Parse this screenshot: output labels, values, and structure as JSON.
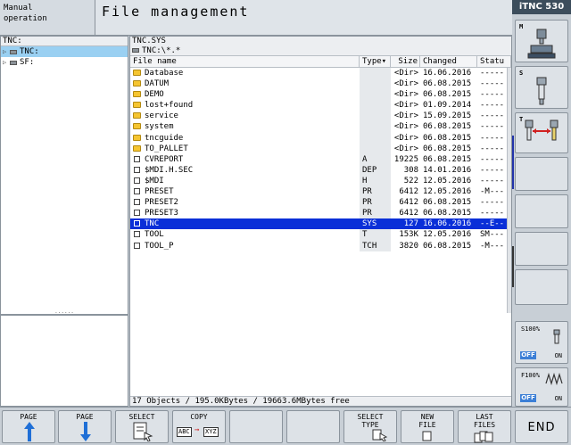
{
  "header": {
    "mode_line1": "Manual",
    "mode_line2": "operation",
    "title": "File management",
    "brand": "iTNC 530"
  },
  "tree": {
    "header": "TNC:",
    "items": [
      {
        "label": "TNC:",
        "selected": true
      },
      {
        "label": "SF:",
        "selected": false
      }
    ],
    "footer": "......"
  },
  "file_table": {
    "path_line1": "TNC.SYS",
    "path_line2": "TNC:\\*.*",
    "columns": {
      "name": "File name",
      "type": "Type▾",
      "size": "Size",
      "changed": "Changed",
      "status": "Statu"
    },
    "rows": [
      {
        "icon": "folder",
        "name": "Database",
        "type": "",
        "size": "<Dir>",
        "changed": "16.06.2016",
        "status": "-----"
      },
      {
        "icon": "folder",
        "name": "DATUM",
        "type": "",
        "size": "<Dir>",
        "changed": "06.08.2015",
        "status": "-----"
      },
      {
        "icon": "folder",
        "name": "DEMO",
        "type": "",
        "size": "<Dir>",
        "changed": "06.08.2015",
        "status": "-----"
      },
      {
        "icon": "folder",
        "name": "lost+found",
        "type": "",
        "size": "<Dir>",
        "changed": "01.09.2014",
        "status": "-----"
      },
      {
        "icon": "folder",
        "name": "service",
        "type": "",
        "size": "<Dir>",
        "changed": "15.09.2015",
        "status": "-----"
      },
      {
        "icon": "folder",
        "name": "system",
        "type": "",
        "size": "<Dir>",
        "changed": "06.08.2015",
        "status": "-----"
      },
      {
        "icon": "folder",
        "name": "tncguide",
        "type": "",
        "size": "<Dir>",
        "changed": "06.08.2015",
        "status": "-----"
      },
      {
        "icon": "folder",
        "name": "TO_PALLET",
        "type": "",
        "size": "<Dir>",
        "changed": "06.08.2015",
        "status": "-----"
      },
      {
        "icon": "file",
        "name": "CVREPORT",
        "type": "A",
        "size": "19225",
        "changed": "06.08.2015",
        "status": "-----"
      },
      {
        "icon": "file",
        "name": "$MDI.H.SEC",
        "type": "DEP",
        "size": "308",
        "changed": "14.01.2016",
        "status": "-----"
      },
      {
        "icon": "file",
        "name": "$MDI",
        "type": "H",
        "size": "522",
        "changed": "12.05.2016",
        "status": "-----"
      },
      {
        "icon": "file",
        "name": "PRESET",
        "type": "PR",
        "size": "6412",
        "changed": "12.05.2016",
        "status": "-M---"
      },
      {
        "icon": "file",
        "name": "PRESET2",
        "type": "PR",
        "size": "6412",
        "changed": "06.08.2015",
        "status": "-----"
      },
      {
        "icon": "file",
        "name": "PRESET3",
        "type": "PR",
        "size": "6412",
        "changed": "06.08.2015",
        "status": "-----"
      },
      {
        "icon": "file",
        "name": "TNC",
        "type": "SYS",
        "size": "127",
        "changed": "16.06.2016",
        "status": "--E--",
        "selected": true
      },
      {
        "icon": "file",
        "name": "TOOL",
        "type": "T",
        "size": "153K",
        "changed": "12.05.2016",
        "status": "SM---"
      },
      {
        "icon": "file",
        "name": "TOOL_P",
        "type": "TCH",
        "size": "3820",
        "changed": "06.08.2015",
        "status": "-M---"
      }
    ],
    "status_line": "17 Objects / 195.0KBytes / 19663.6MBytes free"
  },
  "side_keys": {
    "m_label": "M",
    "s_label": "S",
    "t_label": "T",
    "s_override": "S100%",
    "f_override": "F100%",
    "off_label": "OFF",
    "on_label": "ON"
  },
  "softkeys": {
    "page_up": "PAGE",
    "page_down": "PAGE",
    "select_line1": "SELECT",
    "copy_line1": "COPY",
    "copy_from": "ABC",
    "copy_to": "XYZ",
    "select_type_line1": "SELECT",
    "select_type_line2": "TYPE",
    "new_file_line1": "NEW",
    "new_file_line2": "FILE",
    "last_files_line1": "LAST",
    "last_files_line2": "FILES",
    "end": "END"
  },
  "colors": {
    "selection": "#0a2fd8",
    "tree_selection": "#9ad0f2",
    "folder": "#f5c531",
    "accent_arrow": "#1f6fd6"
  }
}
